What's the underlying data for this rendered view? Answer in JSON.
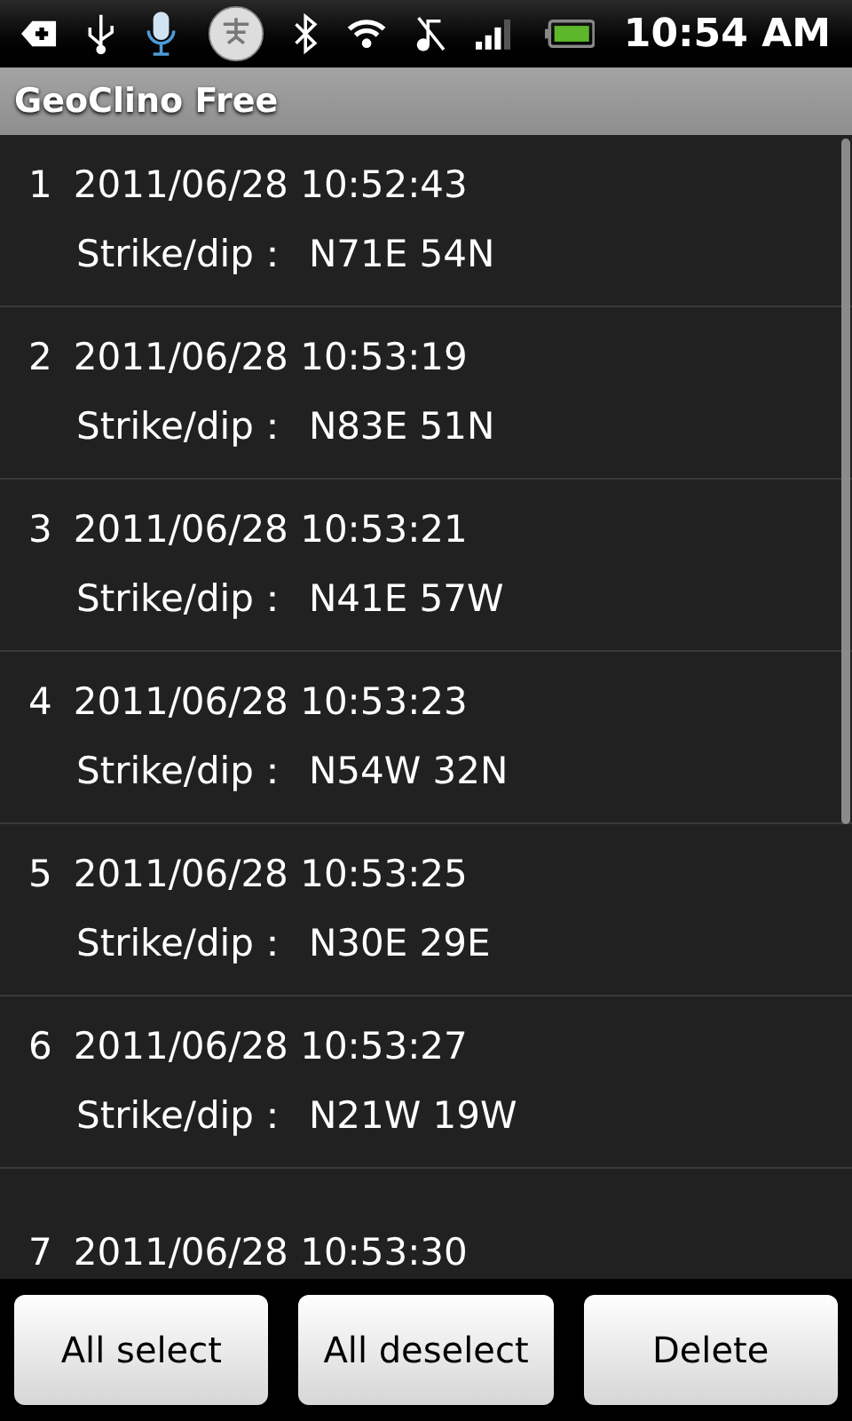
{
  "status_bar": {
    "time": "10:54 AM"
  },
  "title_bar": {
    "title": "GeoClino Free"
  },
  "records": [
    {
      "index": "1",
      "timestamp": "2011/06/28 10:52:43",
      "label": "Strike/dip：",
      "value": "N71E 54N"
    },
    {
      "index": "2",
      "timestamp": "2011/06/28 10:53:19",
      "label": "Strike/dip：",
      "value": "N83E 51N"
    },
    {
      "index": "3",
      "timestamp": "2011/06/28 10:53:21",
      "label": "Strike/dip：",
      "value": "N41E 57W"
    },
    {
      "index": "4",
      "timestamp": "2011/06/28 10:53:23",
      "label": "Strike/dip：",
      "value": "N54W 32N"
    },
    {
      "index": "5",
      "timestamp": "2011/06/28 10:53:25",
      "label": "Strike/dip：",
      "value": "N30E 29E"
    },
    {
      "index": "6",
      "timestamp": "2011/06/28 10:53:27",
      "label": "Strike/dip：",
      "value": "N21W 19W"
    },
    {
      "index": "7",
      "timestamp": "2011/06/28 10:53:30"
    }
  ],
  "buttons": [
    "All select",
    "All deselect",
    "Delete"
  ]
}
